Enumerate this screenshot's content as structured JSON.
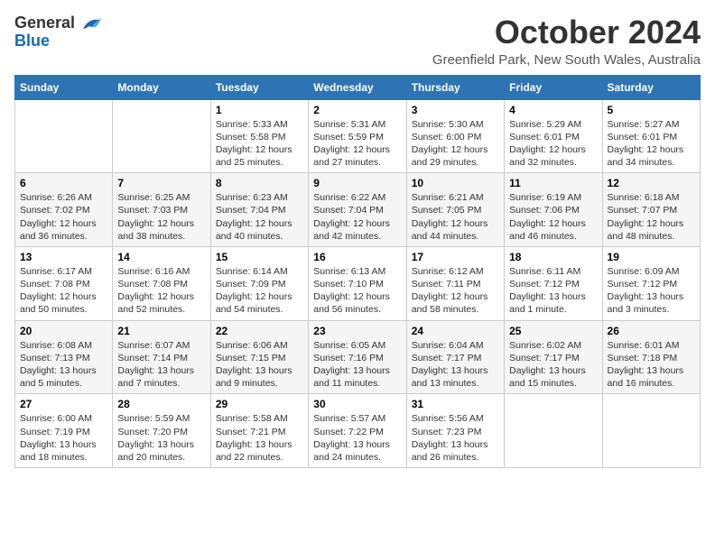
{
  "header": {
    "logo_general": "General",
    "logo_blue": "Blue",
    "month": "October 2024",
    "location": "Greenfield Park, New South Wales, Australia"
  },
  "days_of_week": [
    "Sunday",
    "Monday",
    "Tuesday",
    "Wednesday",
    "Thursday",
    "Friday",
    "Saturday"
  ],
  "weeks": [
    [
      {
        "day": "",
        "info": ""
      },
      {
        "day": "",
        "info": ""
      },
      {
        "day": "1",
        "info": "Sunrise: 5:33 AM\nSunset: 5:58 PM\nDaylight: 12 hours\nand 25 minutes."
      },
      {
        "day": "2",
        "info": "Sunrise: 5:31 AM\nSunset: 5:59 PM\nDaylight: 12 hours\nand 27 minutes."
      },
      {
        "day": "3",
        "info": "Sunrise: 5:30 AM\nSunset: 6:00 PM\nDaylight: 12 hours\nand 29 minutes."
      },
      {
        "day": "4",
        "info": "Sunrise: 5:29 AM\nSunset: 6:01 PM\nDaylight: 12 hours\nand 32 minutes."
      },
      {
        "day": "5",
        "info": "Sunrise: 5:27 AM\nSunset: 6:01 PM\nDaylight: 12 hours\nand 34 minutes."
      }
    ],
    [
      {
        "day": "6",
        "info": "Sunrise: 6:26 AM\nSunset: 7:02 PM\nDaylight: 12 hours\nand 36 minutes."
      },
      {
        "day": "7",
        "info": "Sunrise: 6:25 AM\nSunset: 7:03 PM\nDaylight: 12 hours\nand 38 minutes."
      },
      {
        "day": "8",
        "info": "Sunrise: 6:23 AM\nSunset: 7:04 PM\nDaylight: 12 hours\nand 40 minutes."
      },
      {
        "day": "9",
        "info": "Sunrise: 6:22 AM\nSunset: 7:04 PM\nDaylight: 12 hours\nand 42 minutes."
      },
      {
        "day": "10",
        "info": "Sunrise: 6:21 AM\nSunset: 7:05 PM\nDaylight: 12 hours\nand 44 minutes."
      },
      {
        "day": "11",
        "info": "Sunrise: 6:19 AM\nSunset: 7:06 PM\nDaylight: 12 hours\nand 46 minutes."
      },
      {
        "day": "12",
        "info": "Sunrise: 6:18 AM\nSunset: 7:07 PM\nDaylight: 12 hours\nand 48 minutes."
      }
    ],
    [
      {
        "day": "13",
        "info": "Sunrise: 6:17 AM\nSunset: 7:08 PM\nDaylight: 12 hours\nand 50 minutes."
      },
      {
        "day": "14",
        "info": "Sunrise: 6:16 AM\nSunset: 7:08 PM\nDaylight: 12 hours\nand 52 minutes."
      },
      {
        "day": "15",
        "info": "Sunrise: 6:14 AM\nSunset: 7:09 PM\nDaylight: 12 hours\nand 54 minutes."
      },
      {
        "day": "16",
        "info": "Sunrise: 6:13 AM\nSunset: 7:10 PM\nDaylight: 12 hours\nand 56 minutes."
      },
      {
        "day": "17",
        "info": "Sunrise: 6:12 AM\nSunset: 7:11 PM\nDaylight: 12 hours\nand 58 minutes."
      },
      {
        "day": "18",
        "info": "Sunrise: 6:11 AM\nSunset: 7:12 PM\nDaylight: 13 hours\nand 1 minute."
      },
      {
        "day": "19",
        "info": "Sunrise: 6:09 AM\nSunset: 7:12 PM\nDaylight: 13 hours\nand 3 minutes."
      }
    ],
    [
      {
        "day": "20",
        "info": "Sunrise: 6:08 AM\nSunset: 7:13 PM\nDaylight: 13 hours\nand 5 minutes."
      },
      {
        "day": "21",
        "info": "Sunrise: 6:07 AM\nSunset: 7:14 PM\nDaylight: 13 hours\nand 7 minutes."
      },
      {
        "day": "22",
        "info": "Sunrise: 6:06 AM\nSunset: 7:15 PM\nDaylight: 13 hours\nand 9 minutes."
      },
      {
        "day": "23",
        "info": "Sunrise: 6:05 AM\nSunset: 7:16 PM\nDaylight: 13 hours\nand 11 minutes."
      },
      {
        "day": "24",
        "info": "Sunrise: 6:04 AM\nSunset: 7:17 PM\nDaylight: 13 hours\nand 13 minutes."
      },
      {
        "day": "25",
        "info": "Sunrise: 6:02 AM\nSunset: 7:17 PM\nDaylight: 13 hours\nand 15 minutes."
      },
      {
        "day": "26",
        "info": "Sunrise: 6:01 AM\nSunset: 7:18 PM\nDaylight: 13 hours\nand 16 minutes."
      }
    ],
    [
      {
        "day": "27",
        "info": "Sunrise: 6:00 AM\nSunset: 7:19 PM\nDaylight: 13 hours\nand 18 minutes."
      },
      {
        "day": "28",
        "info": "Sunrise: 5:59 AM\nSunset: 7:20 PM\nDaylight: 13 hours\nand 20 minutes."
      },
      {
        "day": "29",
        "info": "Sunrise: 5:58 AM\nSunset: 7:21 PM\nDaylight: 13 hours\nand 22 minutes."
      },
      {
        "day": "30",
        "info": "Sunrise: 5:57 AM\nSunset: 7:22 PM\nDaylight: 13 hours\nand 24 minutes."
      },
      {
        "day": "31",
        "info": "Sunrise: 5:56 AM\nSunset: 7:23 PM\nDaylight: 13 hours\nand 26 minutes."
      },
      {
        "day": "",
        "info": ""
      },
      {
        "day": "",
        "info": ""
      }
    ]
  ]
}
